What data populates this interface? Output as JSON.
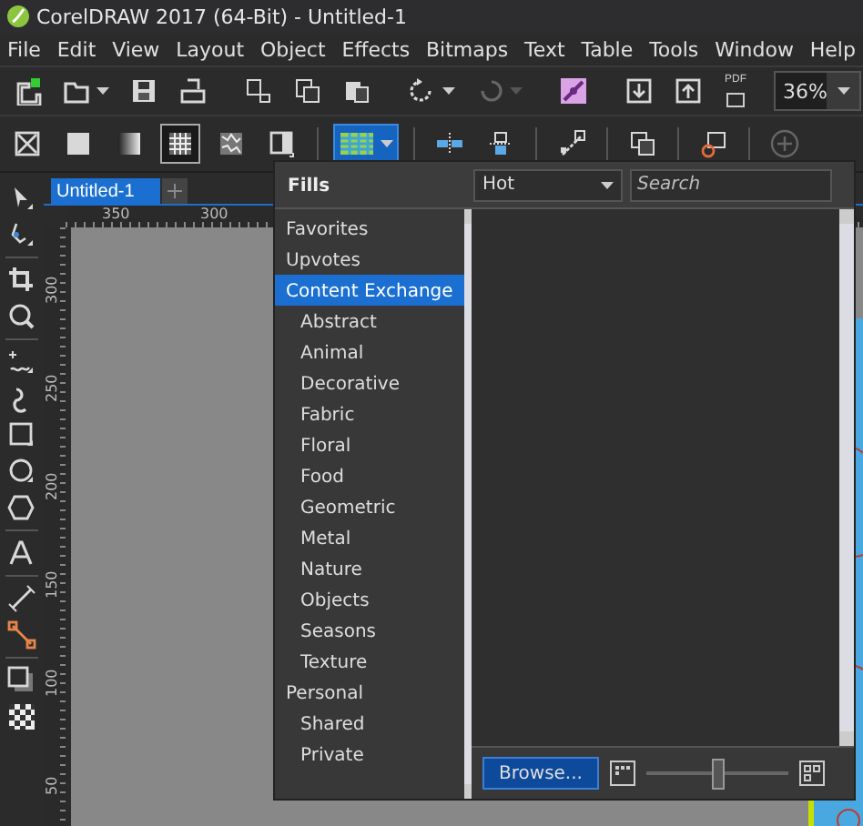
{
  "window": {
    "title": "CorelDRAW 2017 (64-Bit) - Untitled-1"
  },
  "menu": [
    {
      "label": "File"
    },
    {
      "label": "Edit"
    },
    {
      "label": "View"
    },
    {
      "label": "Layout"
    },
    {
      "label": "Object"
    },
    {
      "label": "Effects"
    },
    {
      "label": "Bitmaps"
    },
    {
      "label": "Text"
    },
    {
      "label": "Table"
    },
    {
      "label": "Tools"
    },
    {
      "label": "Window"
    },
    {
      "label": "Help"
    }
  ],
  "standard_toolbar": [
    {
      "kind": "new"
    },
    {
      "kind": "open"
    },
    {
      "kind": "save"
    },
    {
      "kind": "print"
    },
    {
      "kind": "separator"
    },
    {
      "kind": "cut"
    },
    {
      "kind": "copy"
    },
    {
      "kind": "paste"
    },
    {
      "kind": "separator"
    },
    {
      "kind": "undo",
      "disabled": false
    },
    {
      "kind": "redo",
      "disabled": true
    },
    {
      "kind": "separator"
    },
    {
      "kind": "connect"
    },
    {
      "kind": "separator"
    },
    {
      "kind": "import"
    },
    {
      "kind": "export"
    },
    {
      "kind": "pdf",
      "label": "PDF"
    }
  ],
  "zoom": {
    "value": "36%"
  },
  "property_bar": [
    {
      "kind": "no-fill",
      "selected": false
    },
    {
      "kind": "uniform-fill",
      "selected": false
    },
    {
      "kind": "fountain-fill",
      "selected": false
    },
    {
      "kind": "pattern-fill",
      "selected": true
    },
    {
      "kind": "texture-fill",
      "selected": false
    },
    {
      "kind": "postscript-fill",
      "selected": false
    },
    {
      "kind": "separator"
    },
    {
      "kind": "fill-picker",
      "selected": true
    },
    {
      "kind": "separator"
    },
    {
      "kind": "node-left",
      "selected": false
    },
    {
      "kind": "node-right",
      "selected": false
    },
    {
      "kind": "separator"
    },
    {
      "kind": "transform",
      "selected": false
    },
    {
      "kind": "separator"
    },
    {
      "kind": "copy-fill",
      "selected": false
    },
    {
      "kind": "separator"
    },
    {
      "kind": "edit-fill",
      "selected": false
    },
    {
      "kind": "separator"
    },
    {
      "kind": "add",
      "selected": false,
      "disabled": true
    }
  ],
  "toolbox": [
    {
      "kind": "pick"
    },
    {
      "kind": "shape"
    },
    {
      "kind": "separator"
    },
    {
      "kind": "crop"
    },
    {
      "kind": "zoom"
    },
    {
      "kind": "separator"
    },
    {
      "kind": "freehand"
    },
    {
      "kind": "artistic"
    },
    {
      "kind": "rectangle"
    },
    {
      "kind": "ellipse"
    },
    {
      "kind": "polygon"
    },
    {
      "kind": "separator"
    },
    {
      "kind": "text"
    },
    {
      "kind": "separator"
    },
    {
      "kind": "dimension"
    },
    {
      "kind": "connector"
    },
    {
      "kind": "separator"
    },
    {
      "kind": "shadow"
    },
    {
      "kind": "transparency"
    }
  ],
  "document_tabs": [
    {
      "label": "Untitled-1",
      "selected": true
    }
  ],
  "rulers": {
    "horizontal": [
      "350",
      "300"
    ],
    "vertical": [
      "300",
      "250",
      "200",
      "150",
      "100",
      "50"
    ]
  },
  "fills_popup": {
    "title": "Fills",
    "categories": [
      {
        "label": "Favorites",
        "selected": false
      },
      {
        "label": "Upvotes",
        "selected": false
      },
      {
        "label": "Content Exchange",
        "selected": true,
        "children": [
          {
            "label": "Abstract",
            "selected": false
          },
          {
            "label": "Animal",
            "selected": false
          },
          {
            "label": "Decorative",
            "selected": false
          },
          {
            "label": "Fabric",
            "selected": false
          },
          {
            "label": "Floral",
            "selected": false
          },
          {
            "label": "Food",
            "selected": false
          },
          {
            "label": "Geometric",
            "selected": false
          },
          {
            "label": "Metal",
            "selected": false
          },
          {
            "label": "Nature",
            "selected": false
          },
          {
            "label": "Objects",
            "selected": false
          },
          {
            "label": "Seasons",
            "selected": false
          },
          {
            "label": "Texture",
            "selected": false
          }
        ]
      },
      {
        "label": "Personal",
        "selected": false,
        "children": [
          {
            "label": "Shared",
            "selected": false
          },
          {
            "label": "Private",
            "selected": false
          }
        ]
      }
    ],
    "sort": {
      "value": "Hot"
    },
    "search": {
      "placeholder": "Search"
    },
    "browse_button": "Browse...",
    "thumbnail_size": {
      "level": 0.5
    }
  }
}
